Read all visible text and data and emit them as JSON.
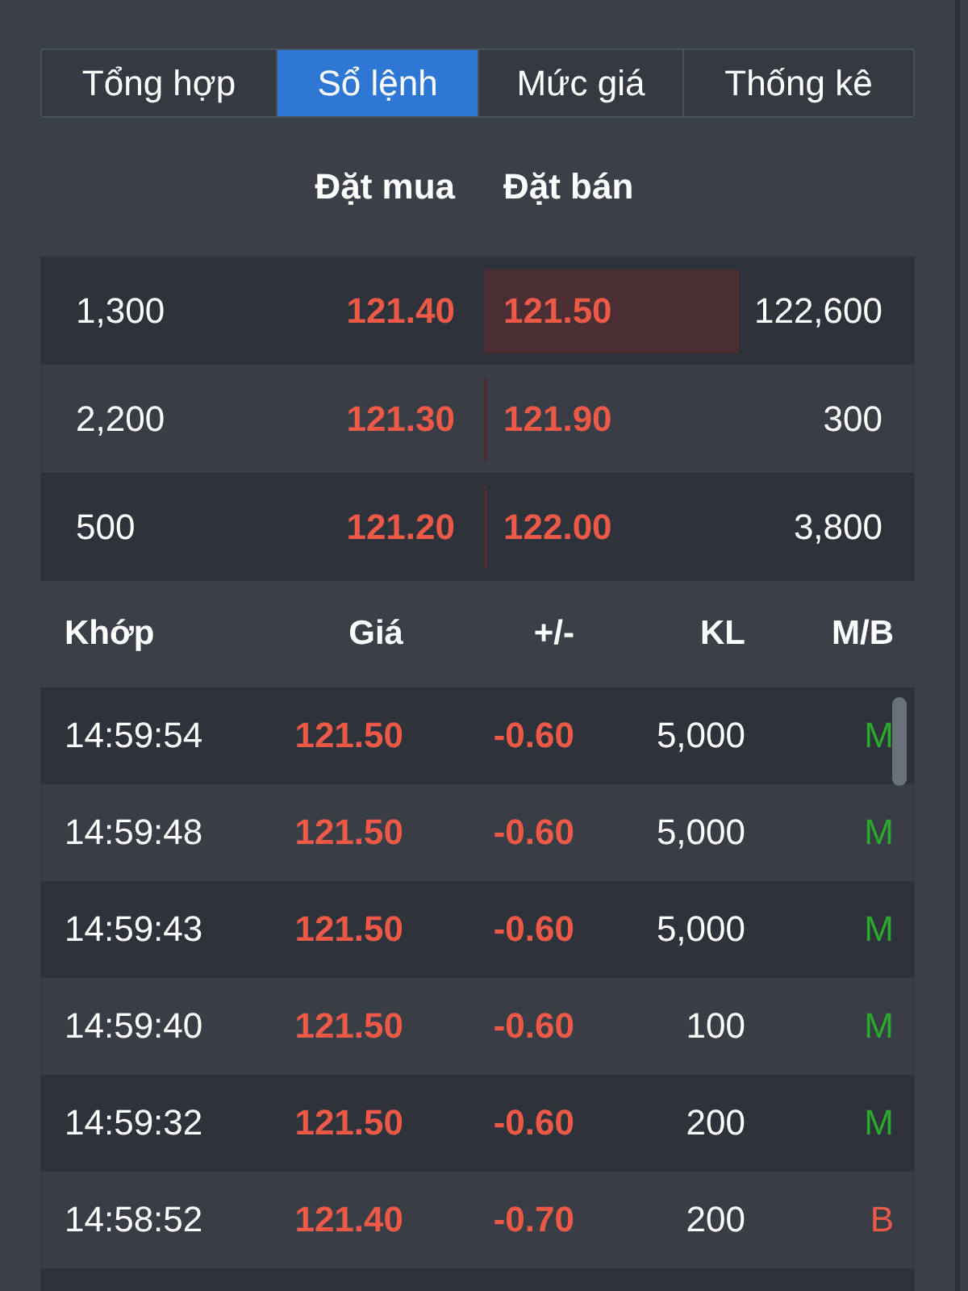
{
  "tabs": [
    {
      "label": "Tổng hợp",
      "selected": false
    },
    {
      "label": "Sổ lệnh",
      "selected": true
    },
    {
      "label": "Mức giá",
      "selected": false
    },
    {
      "label": "Thống kê",
      "selected": false
    }
  ],
  "order_book": {
    "bid_header": "Đặt mua",
    "ask_header": "Đặt bán",
    "rows": [
      {
        "bid_volume": "1,300",
        "bid_price": "121.40",
        "ask_price": "121.50",
        "ask_volume": "122,600",
        "ask_bar": {
          "level": 0.66
        }
      },
      {
        "bid_volume": "2,200",
        "bid_price": "121.30",
        "ask_price": "121.90",
        "ask_volume": "300",
        "ask_bar": {
          "level": 0.01
        }
      },
      {
        "bid_volume": "500",
        "bid_price": "121.20",
        "ask_price": "122.00",
        "ask_volume": "3,800",
        "ask_bar": {
          "level": 0.01
        }
      }
    ]
  },
  "trades": {
    "columns": [
      "Khớp",
      "Giá",
      "+/-",
      "KL",
      "M/B"
    ],
    "rows": [
      {
        "time": "14:59:54",
        "price": "121.50",
        "change": "-0.60",
        "volume": "5,000",
        "side": "M",
        "kind": "buy"
      },
      {
        "time": "14:59:48",
        "price": "121.50",
        "change": "-0.60",
        "volume": "5,000",
        "side": "M",
        "kind": "buy"
      },
      {
        "time": "14:59:43",
        "price": "121.50",
        "change": "-0.60",
        "volume": "5,000",
        "side": "M",
        "kind": "buy"
      },
      {
        "time": "14:59:40",
        "price": "121.50",
        "change": "-0.60",
        "volume": "100",
        "side": "M",
        "kind": "buy"
      },
      {
        "time": "14:59:32",
        "price": "121.50",
        "change": "-0.60",
        "volume": "200",
        "side": "M",
        "kind": "buy"
      },
      {
        "time": "14:58:52",
        "price": "121.40",
        "change": "-0.70",
        "volume": "200",
        "side": "B",
        "kind": "sell"
      }
    ]
  }
}
